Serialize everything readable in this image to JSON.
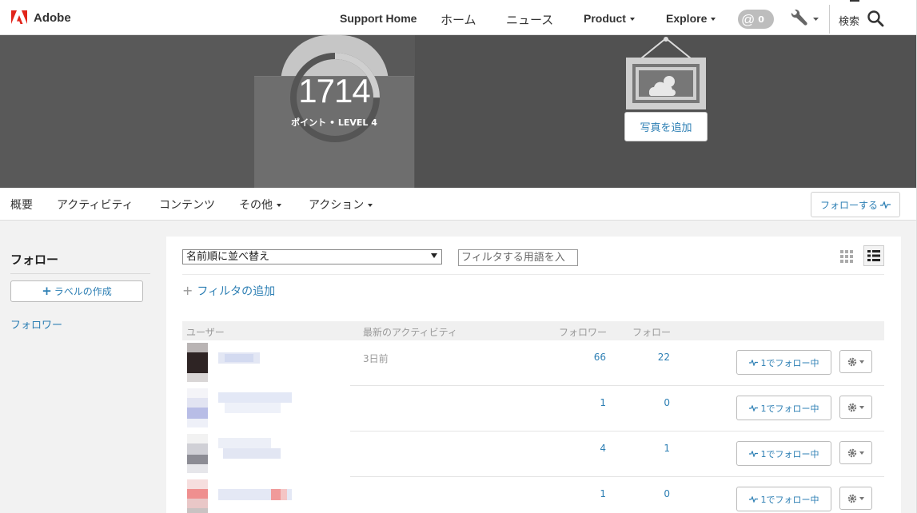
{
  "brand": {
    "name": "Adobe",
    "color": "#e1251b"
  },
  "topnav": {
    "support_home": "Support Home",
    "home": "ホーム",
    "news": "ニュース",
    "product": "Product",
    "explore": "Explore",
    "mention_count": "0",
    "search_label": "検索"
  },
  "profile": {
    "points": "1714",
    "points_label": "ポイント • LEVEL 4",
    "points_progress_fraction": 0.25,
    "add_photo": "写真を追加"
  },
  "tabs": {
    "overview": "概要",
    "activity": "アクティビティ",
    "content": "コンテンツ",
    "more": "その他",
    "actions": "アクション",
    "follow_button": "フォローする"
  },
  "sidebar": {
    "title": "フォロー",
    "create_label": "ラベルの作成",
    "followers_link": "フォロワー"
  },
  "toolbar": {
    "sort_value": "名前順に並べ替え",
    "filter_placeholder": "フィルタする用語を入",
    "add_filter": "フィルタの追加"
  },
  "table": {
    "headers": {
      "user": "ユーザー",
      "recent_activity": "最新のアクティビティ",
      "followers": "フォロワー",
      "following": "フォロー"
    },
    "rows": [
      {
        "recent": "3日前",
        "followers": "66",
        "following": "22",
        "follow_label": "1でフォロー中"
      },
      {
        "recent": "",
        "followers": "1",
        "following": "0",
        "follow_label": "1でフォロー中"
      },
      {
        "recent": "",
        "followers": "4",
        "following": "1",
        "follow_label": "1でフォロー中"
      },
      {
        "recent": "",
        "followers": "1",
        "following": "0",
        "follow_label": "1でフォロー中"
      }
    ]
  },
  "colors": {
    "link": "#2d7fb4",
    "hero_left": "#595959",
    "hero_right": "#515151",
    "page_bg": "#f2f2f2"
  }
}
